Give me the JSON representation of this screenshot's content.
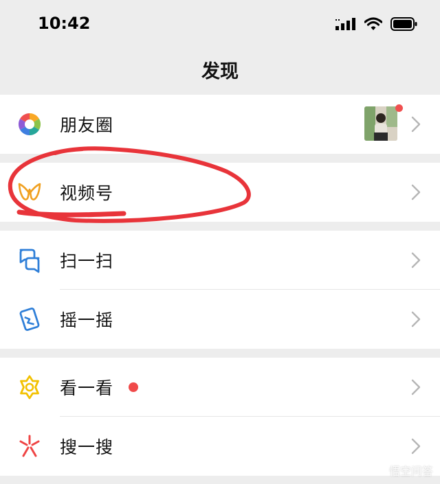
{
  "status_bar": {
    "time": "10:42"
  },
  "header": {
    "title": "发现"
  },
  "groups": [
    {
      "items": [
        {
          "label": "朋友圈",
          "icon": "moments-icon",
          "has_thumbnail": true,
          "has_badge": true
        }
      ]
    },
    {
      "items": [
        {
          "label": "视频号",
          "icon": "channels-icon"
        }
      ]
    },
    {
      "items": [
        {
          "label": "扫一扫",
          "icon": "scan-icon"
        },
        {
          "label": "摇一摇",
          "icon": "shake-icon"
        }
      ]
    },
    {
      "items": [
        {
          "label": "看一看",
          "icon": "top-stories-icon",
          "has_badge": true
        },
        {
          "label": "搜一搜",
          "icon": "search-icon"
        }
      ]
    }
  ],
  "watermark": {
    "text": "悟空问答"
  },
  "colors": {
    "background": "#ededed",
    "badge": "#f05050",
    "annotation": "#e8343a"
  }
}
